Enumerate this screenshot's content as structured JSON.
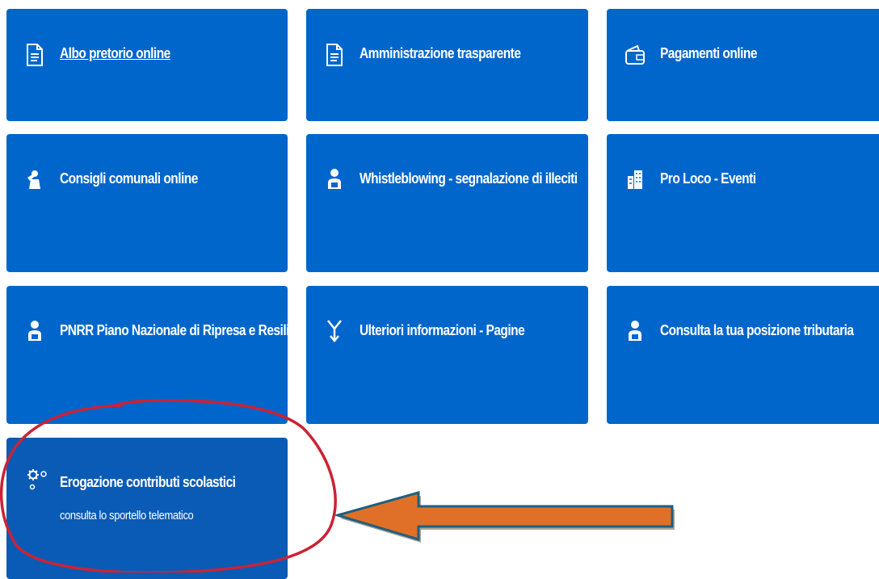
{
  "colors": {
    "tile_background": "#0066cc",
    "tile_background_highlighted": "#0a5bb5",
    "tile_text": "#ffffff",
    "annotation_circle": "#cc2233",
    "annotation_arrow_fill": "#e07028",
    "annotation_arrow_outline": "#1e5f80"
  },
  "tiles": [
    {
      "label": "Albo pretorio online",
      "icon": "document-icon"
    },
    {
      "label": "Amministrazione trasparente",
      "icon": "document-icon"
    },
    {
      "label": "Pagamenti online",
      "icon": "wallet-icon"
    },
    {
      "label": "Consigli comunali online",
      "icon": "meeting-icon"
    },
    {
      "label": "Whistleblowing - segnalazione di illeciti",
      "icon": "user-icon"
    },
    {
      "label": "Pro Loco - Eventi",
      "icon": "buildings-icon"
    },
    {
      "label": "PNRR Piano Nazionale di Ripresa e Resilienza",
      "icon": "user-icon"
    },
    {
      "label": "Ulteriori informazioni - Pagine",
      "icon": "fork-arrow-icon"
    },
    {
      "label": "Consulta la tua posizione tributaria",
      "icon": "user-icon"
    },
    {
      "label": "Erogazione contributi scolastici",
      "subtitle": "consulta lo sportello telematico",
      "icon": "gears-icon"
    }
  ],
  "annotations": {
    "circle": "red-hand-drawn-circle",
    "arrow": "orange-arrow-pointing-left"
  }
}
